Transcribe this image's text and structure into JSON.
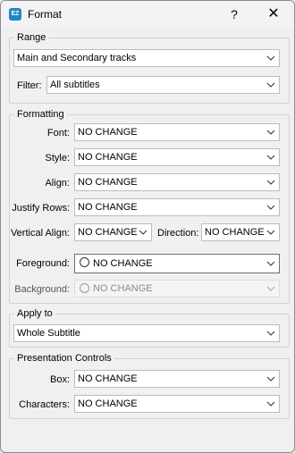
{
  "window": {
    "title": "Format",
    "help": "?",
    "close": "✕",
    "app_icon_text": "EZ"
  },
  "range": {
    "legend": "Range",
    "tracks_value": "Main and Secondary tracks",
    "filter_label": "Filter:",
    "filter_value": "All subtitles"
  },
  "formatting": {
    "legend": "Formatting",
    "font_label": "Font:",
    "font_value": "NO CHANGE",
    "style_label": "Style:",
    "style_value": "NO CHANGE",
    "align_label": "Align:",
    "align_value": "NO CHANGE",
    "justify_label": "Justify Rows:",
    "justify_value": "NO CHANGE",
    "valign_label": "Vertical Align:",
    "valign_value": "NO CHANGE",
    "direction_label": "Direction:",
    "direction_value": "NO CHANGE",
    "foreground_label": "Foreground:",
    "foreground_value": "NO CHANGE",
    "background_label": "Background:",
    "background_value": "NO CHANGE"
  },
  "apply_to": {
    "legend": "Apply to",
    "value": "Whole Subtitle"
  },
  "presentation": {
    "legend": "Presentation Controls",
    "box_label": "Box:",
    "box_value": "NO CHANGE",
    "characters_label": "Characters:",
    "characters_value": "NO CHANGE"
  },
  "colors": {
    "app_icon": "#1f86c7",
    "disabled_text": "#8a8a8a"
  }
}
